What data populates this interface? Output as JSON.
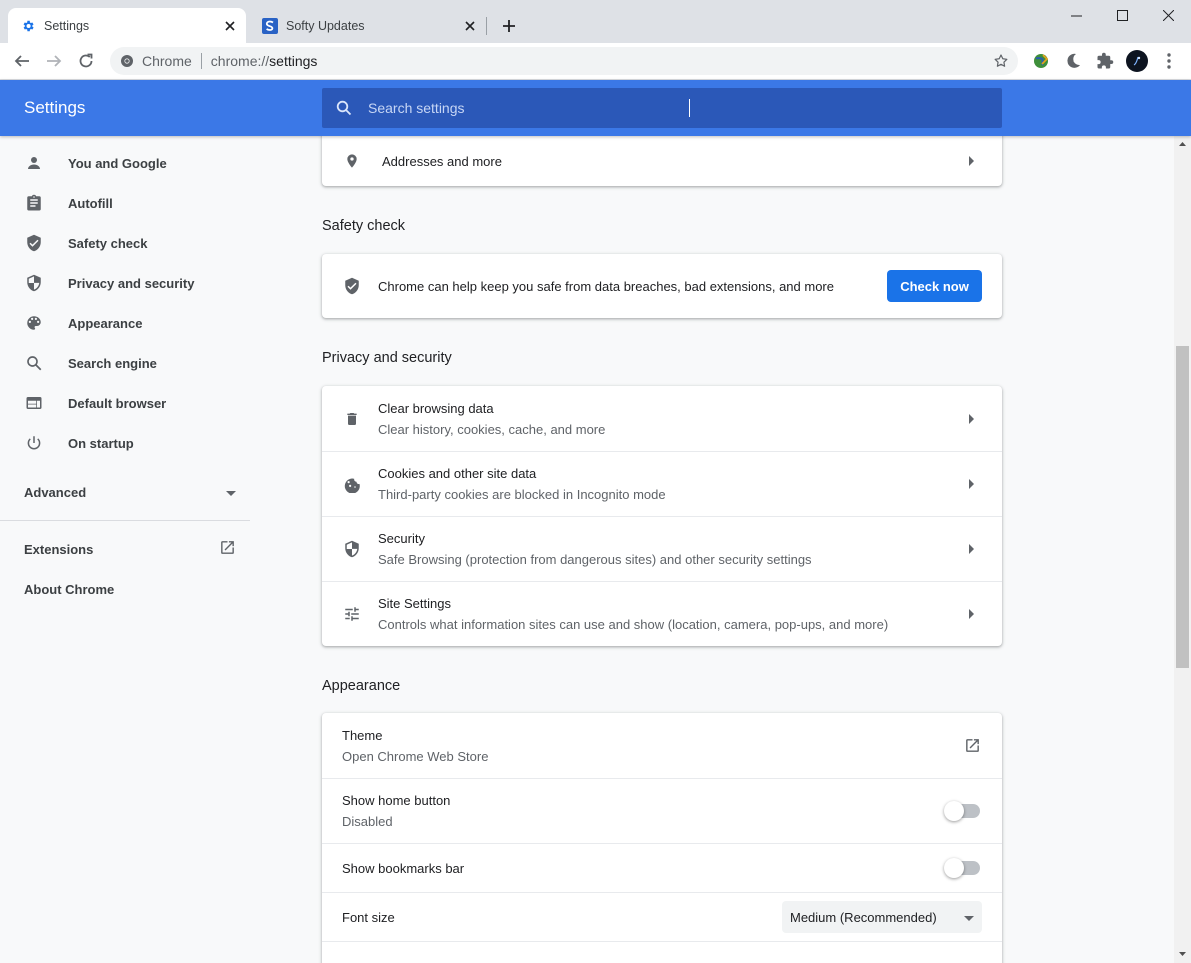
{
  "tabs": [
    {
      "title": "Settings",
      "active": true
    },
    {
      "title": "Softy Updates",
      "active": false
    }
  ],
  "omnibox": {
    "site_label": "Chrome",
    "url_scheme": "chrome://",
    "url_path": "settings"
  },
  "header": {
    "title": "Settings",
    "search_placeholder": "Search settings"
  },
  "sidebar": {
    "items": [
      {
        "label": "You and Google",
        "icon": "person-icon"
      },
      {
        "label": "Autofill",
        "icon": "clipboard-icon"
      },
      {
        "label": "Safety check",
        "icon": "shield-check-icon"
      },
      {
        "label": "Privacy and security",
        "icon": "shield-half-icon"
      },
      {
        "label": "Appearance",
        "icon": "palette-icon"
      },
      {
        "label": "Search engine",
        "icon": "search-icon"
      },
      {
        "label": "Default browser",
        "icon": "browser-icon"
      },
      {
        "label": "On startup",
        "icon": "power-icon"
      }
    ],
    "advanced_label": "Advanced",
    "extensions_label": "Extensions",
    "about_label": "About Chrome"
  },
  "main": {
    "autofill_addresses_label": "Addresses and more",
    "safety_check": {
      "title": "Safety check",
      "description": "Chrome can help keep you safe from data breaches, bad extensions, and more",
      "button_label": "Check now"
    },
    "privacy": {
      "title": "Privacy and security",
      "rows": [
        {
          "primary": "Clear browsing data",
          "secondary": "Clear history, cookies, cache, and more"
        },
        {
          "primary": "Cookies and other site data",
          "secondary": "Third-party cookies are blocked in Incognito mode"
        },
        {
          "primary": "Security",
          "secondary": "Safe Browsing (protection from dangerous sites) and other security settings"
        },
        {
          "primary": "Site Settings",
          "secondary": "Controls what information sites can use and show (location, camera, pop-ups, and more)"
        }
      ]
    },
    "appearance": {
      "title": "Appearance",
      "theme_label": "Theme",
      "theme_sub": "Open Chrome Web Store",
      "home_button_label": "Show home button",
      "home_button_sub": "Disabled",
      "bookmarks_bar_label": "Show bookmarks bar",
      "font_size_label": "Font size",
      "font_size_value": "Medium (Recommended)"
    }
  },
  "colors": {
    "header_blue": "#3b78e7",
    "button_blue": "#1a73e8",
    "search_box": "#2b58b8"
  }
}
